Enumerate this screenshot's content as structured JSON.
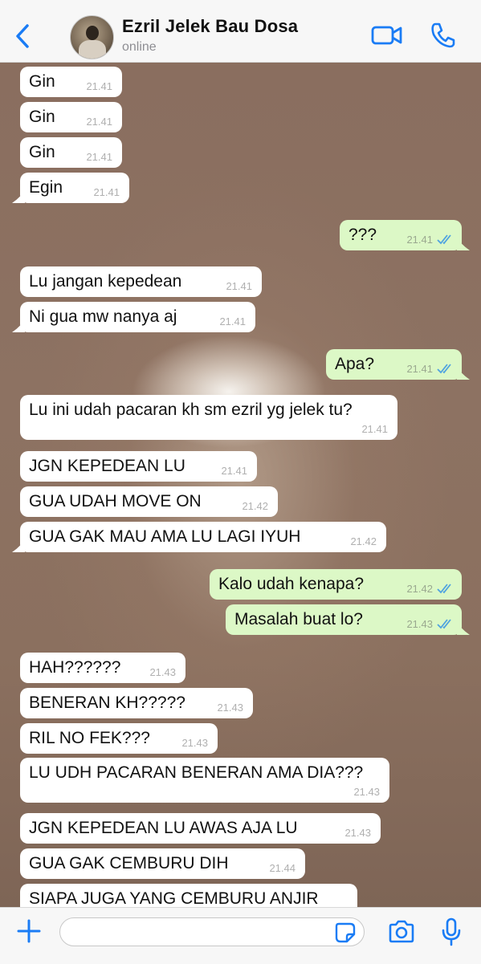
{
  "header": {
    "back_icon": "chevron-left-icon",
    "contact_name": "Ezril Jelek Bau Dosa",
    "status": "online",
    "video_icon": "video-camera-icon",
    "call_icon": "phone-icon",
    "accent_color": "#1a7cf5"
  },
  "messages": [
    {
      "dir": "in",
      "text": "Gin",
      "time": "21.41"
    },
    {
      "dir": "in",
      "text": "Gin",
      "time": "21.41"
    },
    {
      "dir": "in",
      "text": "Gin",
      "time": "21.41"
    },
    {
      "dir": "in",
      "text": "Egin",
      "time": "21.41"
    },
    {
      "dir": "out",
      "text": "???",
      "time": "21.41"
    },
    {
      "dir": "in",
      "text": "Lu jangan kepedean",
      "time": "21.41"
    },
    {
      "dir": "in",
      "text": "Ni gua mw nanya aj",
      "time": "21.41"
    },
    {
      "dir": "out",
      "text": "Apa?",
      "time": "21.41"
    },
    {
      "dir": "in",
      "text": "Lu ini udah pacaran kh sm ezril yg jelek tu?",
      "time": "21.41"
    },
    {
      "dir": "in",
      "text": "JGN KEPEDEAN LU",
      "time": "21.41"
    },
    {
      "dir": "in",
      "text": "GUA UDAH MOVE ON",
      "time": "21.42"
    },
    {
      "dir": "in",
      "text": "GUA GAK MAU AMA LU LAGI IYUH",
      "time": "21.42"
    },
    {
      "dir": "out",
      "text": "Kalo udah kenapa?",
      "time": "21.42"
    },
    {
      "dir": "out",
      "text": "Masalah buat lo?",
      "time": "21.43"
    },
    {
      "dir": "in",
      "text": "HAH??????",
      "time": "21.43"
    },
    {
      "dir": "in",
      "text": "BENERAN KH?????",
      "time": "21.43"
    },
    {
      "dir": "in",
      "text": "RIL NO FEK???",
      "time": "21.43"
    },
    {
      "dir": "in",
      "text": "LU UDH PACARAN BENERAN AMA DIA???",
      "time": "21.43"
    },
    {
      "dir": "in",
      "text": "JGN KEPEDEAN LU AWAS AJA LU",
      "time": "21.43"
    },
    {
      "dir": "in",
      "text": "GUA GAK CEMBURU DIH",
      "time": "21.44"
    },
    {
      "dir": "in",
      "text": "SIAPA JUGA YANG CEMBURU ANJIR",
      "time": ""
    }
  ],
  "input_bar": {
    "plus_icon": "plus-icon",
    "message_value": "",
    "sticker_icon": "sticker-icon",
    "camera_icon": "camera-icon",
    "mic_icon": "microphone-icon"
  },
  "colors": {
    "incoming_bubble": "#ffffff",
    "outgoing_bubble": "#dcf8c6",
    "read_ticks": "#4fa3e0"
  }
}
